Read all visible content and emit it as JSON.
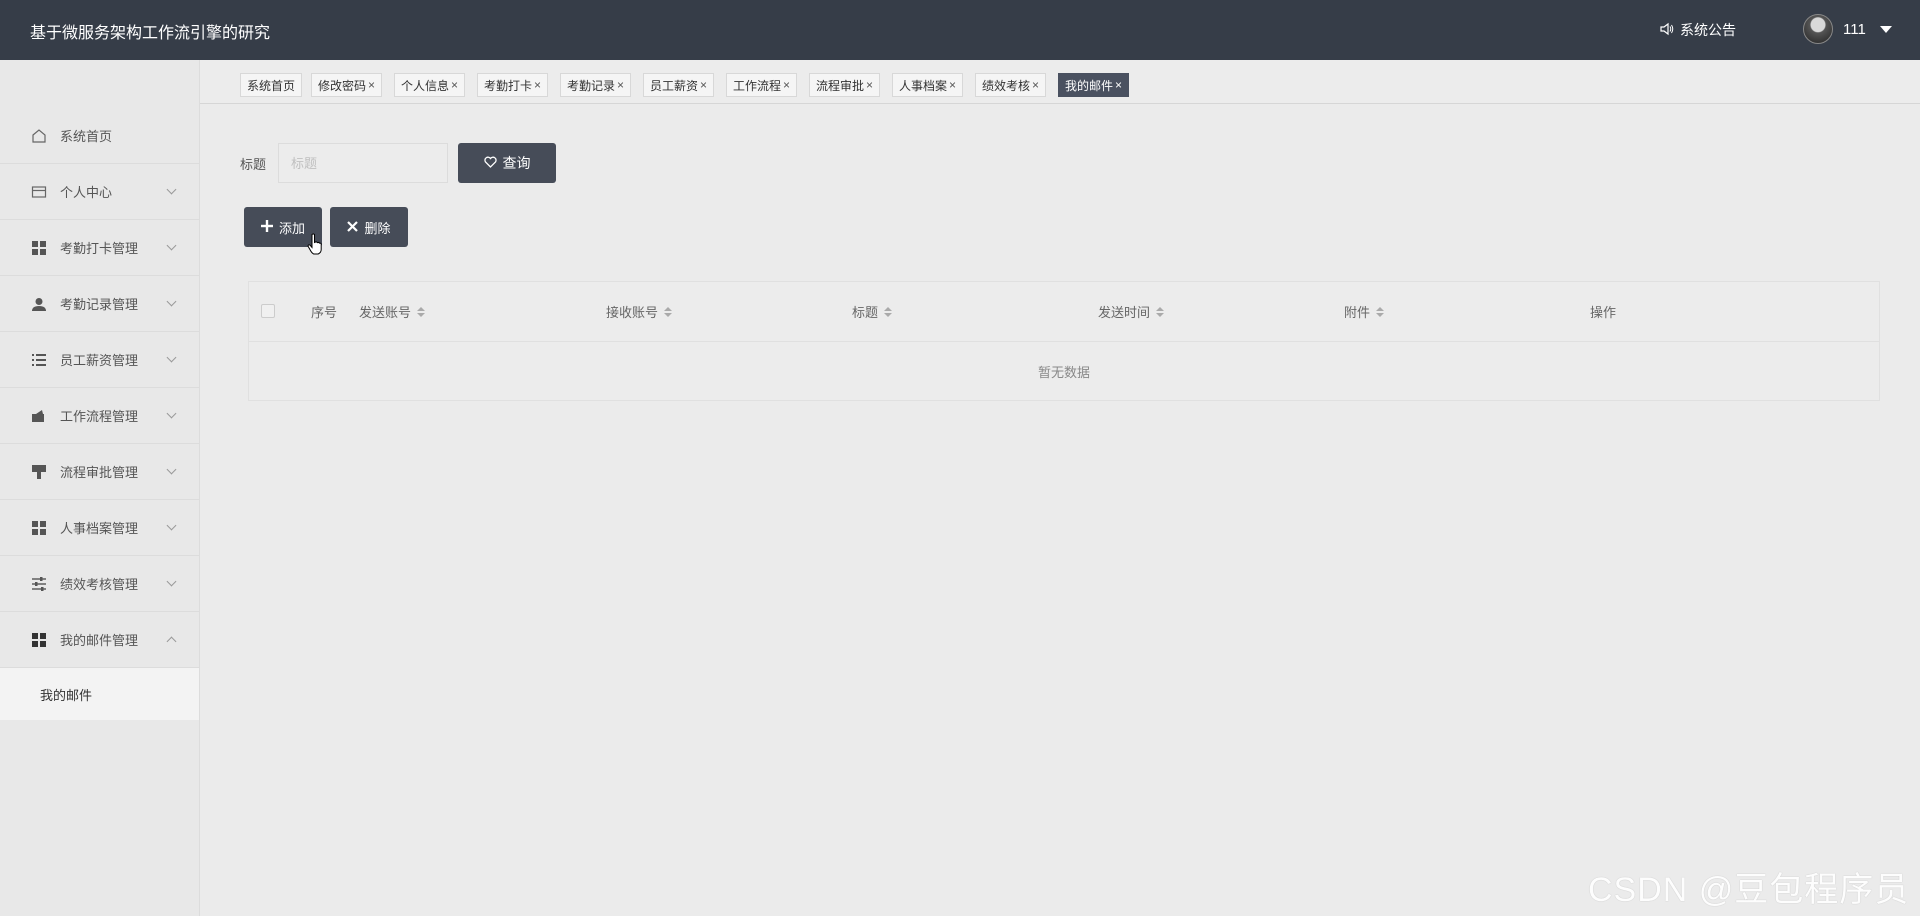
{
  "header": {
    "app_title": "基于微服务架构工作流引擎的研究",
    "notice_label": "系统公告",
    "username": "111"
  },
  "sidebar": {
    "items": [
      {
        "label": "系统首页",
        "icon": "home-icon"
      },
      {
        "label": "个人中心",
        "icon": "card-icon"
      },
      {
        "label": "考勤打卡管理",
        "icon": "grid-icon"
      },
      {
        "label": "考勤记录管理",
        "icon": "user-icon"
      },
      {
        "label": "员工薪资管理",
        "icon": "list-icon"
      },
      {
        "label": "工作流程管理",
        "icon": "wallet-icon"
      },
      {
        "label": "流程审批管理",
        "icon": "stamp-icon"
      },
      {
        "label": "人事档案管理",
        "icon": "grid-icon"
      },
      {
        "label": "绩效考核管理",
        "icon": "sliders-icon"
      },
      {
        "label": "我的邮件管理",
        "icon": "grid-icon"
      }
    ],
    "submenu": {
      "label": "我的邮件"
    }
  },
  "tabs": [
    {
      "label": "系统首页"
    },
    {
      "label": "修改密码"
    },
    {
      "label": "个人信息"
    },
    {
      "label": "考勤打卡"
    },
    {
      "label": "考勤记录"
    },
    {
      "label": "员工薪资"
    },
    {
      "label": "工作流程"
    },
    {
      "label": "流程审批"
    },
    {
      "label": "人事档案"
    },
    {
      "label": "绩效考核"
    },
    {
      "label": "我的邮件",
      "active": true
    }
  ],
  "tab_close_glyph": "×",
  "search": {
    "label": "标题",
    "placeholder": "标题",
    "query_button": "查询"
  },
  "actions": {
    "add_button": "添加",
    "delete_button": "删除"
  },
  "table": {
    "columns": [
      "序号",
      "发送账号",
      "接收账号",
      "标题",
      "发送时间",
      "附件",
      "操作"
    ],
    "empty_text": "暂无数据"
  },
  "watermark": "CSDN @豆包程序员",
  "colors": {
    "header_bg": "#363d48",
    "button_bg": "#464c58",
    "active_tab_bg": "#4a5160"
  }
}
